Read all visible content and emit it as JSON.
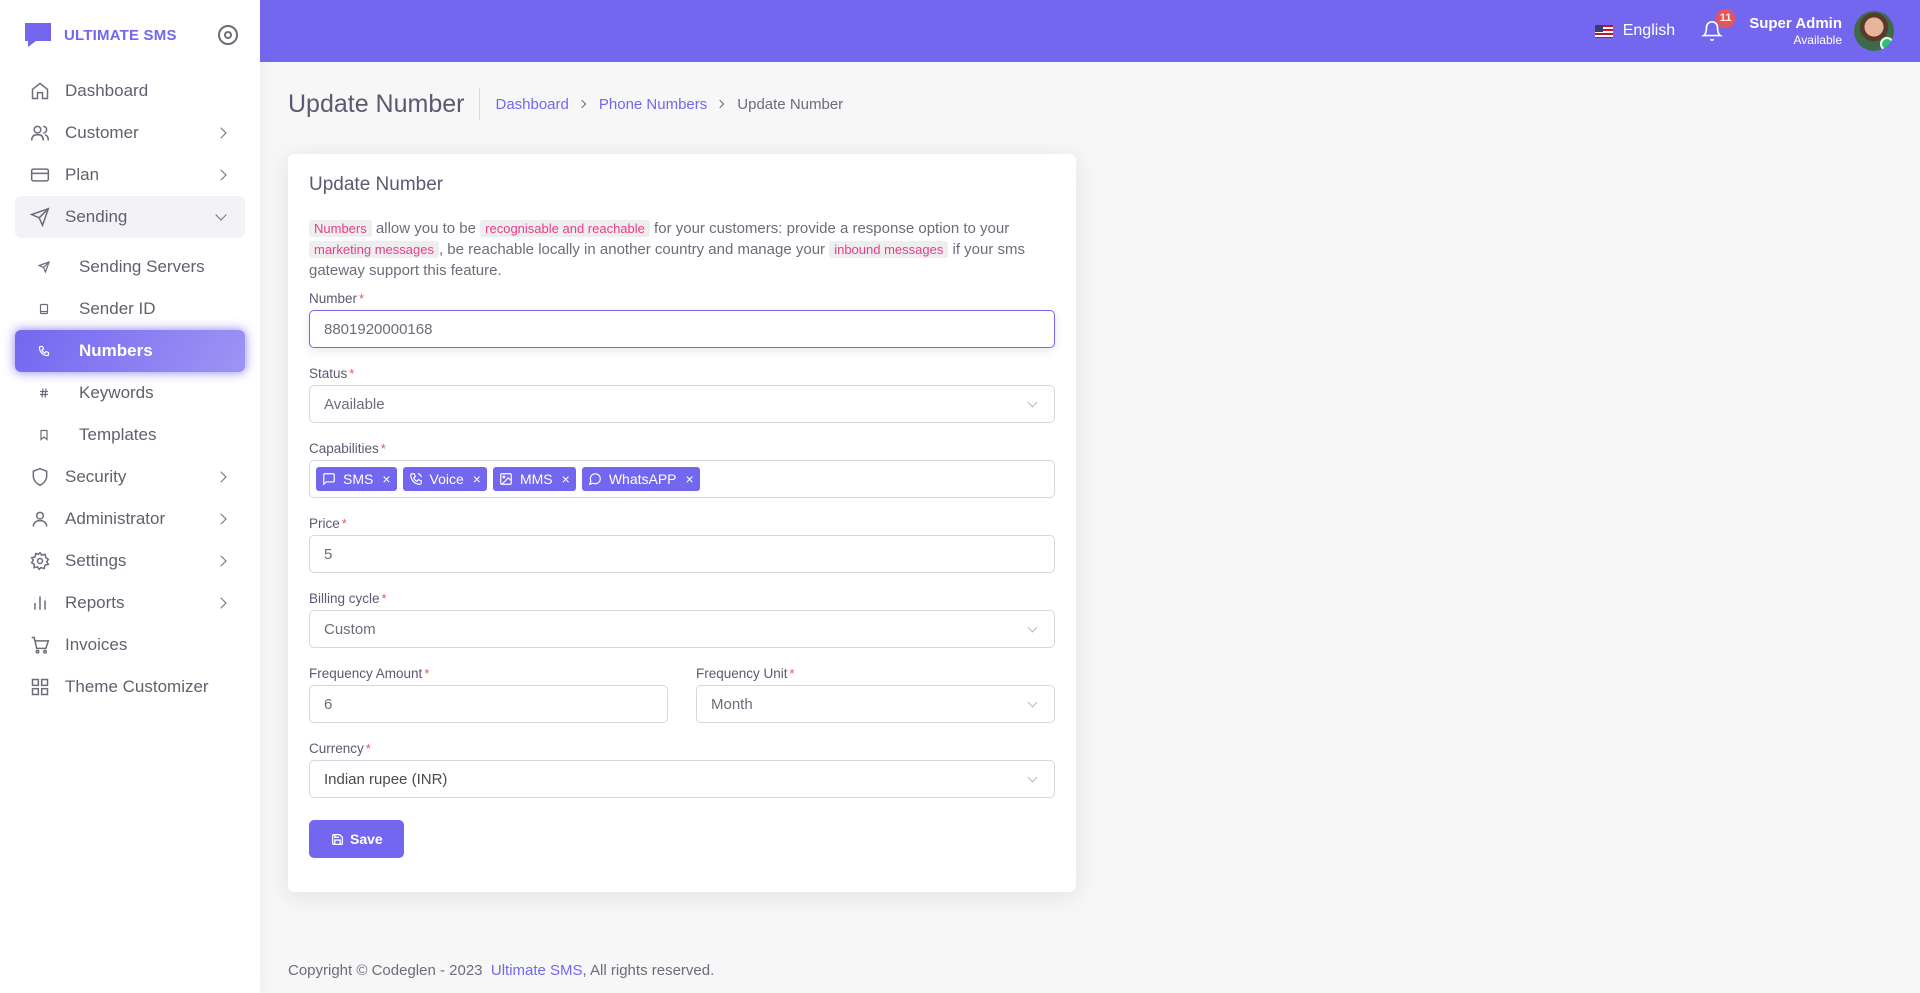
{
  "brand": {
    "name": "ULTIMATE SMS"
  },
  "sidebar": {
    "items": [
      {
        "label": "Dashboard",
        "icon": "home-icon"
      },
      {
        "label": "Customer",
        "icon": "users-icon"
      },
      {
        "label": "Plan",
        "icon": "credit-card-icon"
      },
      {
        "label": "Sending",
        "icon": "send-icon"
      },
      {
        "label": "Sending Servers",
        "icon": "send-small-icon"
      },
      {
        "label": "Sender ID",
        "icon": "book-icon"
      },
      {
        "label": "Numbers",
        "icon": "phone-icon"
      },
      {
        "label": "Keywords",
        "icon": "hash-icon"
      },
      {
        "label": "Templates",
        "icon": "bookmark-icon"
      },
      {
        "label": "Security",
        "icon": "shield-icon"
      },
      {
        "label": "Administrator",
        "icon": "user-icon"
      },
      {
        "label": "Settings",
        "icon": "gear-icon"
      },
      {
        "label": "Reports",
        "icon": "bar-chart-icon"
      },
      {
        "label": "Invoices",
        "icon": "cart-icon"
      },
      {
        "label": "Theme Customizer",
        "icon": "grid-icon"
      }
    ]
  },
  "header": {
    "language": "English",
    "notification_count": "11",
    "user_name": "Super Admin",
    "user_status": "Available"
  },
  "page": {
    "title": "Update Number",
    "breadcrumb": [
      "Dashboard",
      "Phone Numbers",
      "Update Number"
    ]
  },
  "form": {
    "card_title": "Update Number",
    "intro": {
      "tag1": "Numbers",
      "text1": " allow you to be ",
      "tag2": "recognisable and reachable",
      "text2": " for your customers: provide a response option to your ",
      "tag3": "marketing messages",
      "text3": ", be reachable locally in another country and manage your ",
      "tag4": "inbound messages",
      "text4": " if your sms gateway support this feature."
    },
    "number": {
      "label": "Number",
      "value": "8801920000168"
    },
    "status": {
      "label": "Status",
      "value": "Available"
    },
    "capabilities": {
      "label": "Capabilities",
      "chips": [
        "SMS",
        "Voice",
        "MMS",
        "WhatsAPP"
      ]
    },
    "price": {
      "label": "Price",
      "value": "5"
    },
    "billing_cycle": {
      "label": "Billing cycle",
      "value": "Custom"
    },
    "frequency_amount": {
      "label": "Frequency Amount",
      "value": "6"
    },
    "frequency_unit": {
      "label": "Frequency Unit",
      "value": "Month"
    },
    "currency": {
      "label": "Currency",
      "value": "Indian rupee (INR)"
    },
    "required_mark": "*",
    "save_label": "Save"
  },
  "footer": {
    "text": "Copyright © Codeglen - 2023",
    "link": "Ultimate SMS",
    "suffix": ", All rights reserved."
  },
  "colors": {
    "accent": "#7367f0",
    "danger": "#ea5455",
    "code_tag": "#e83e8c"
  }
}
